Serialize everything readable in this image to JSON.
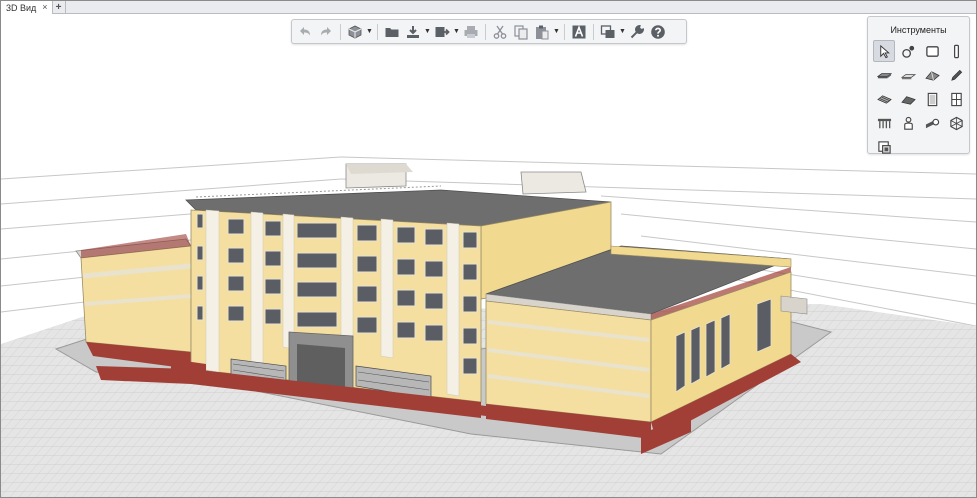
{
  "tabs": [
    {
      "label": "3D Вид",
      "close_glyph": "×"
    }
  ],
  "add_tab_glyph": "+",
  "toolbar": {
    "buttons": [
      {
        "name": "undo-button",
        "icon": "undo-icon"
      },
      {
        "name": "redo-button",
        "icon": "redo-icon"
      },
      {
        "name": "view-cube-button",
        "icon": "cube-icon",
        "dropdown": true
      },
      {
        "name": "open-folder-button",
        "icon": "folder-icon"
      },
      {
        "name": "import-button",
        "icon": "import-icon",
        "dropdown": true
      },
      {
        "name": "export-button",
        "icon": "export-icon",
        "dropdown": true
      },
      {
        "name": "print-button",
        "icon": "printer-icon"
      },
      {
        "name": "cut-button",
        "icon": "scissors-icon"
      },
      {
        "name": "copy-button",
        "icon": "copy-icon"
      },
      {
        "name": "paste-button",
        "icon": "paste-icon",
        "dropdown": true
      },
      {
        "name": "text-style-button",
        "icon": "text-a-icon"
      },
      {
        "name": "layers-button",
        "icon": "layers-icon",
        "dropdown": true
      },
      {
        "name": "settings-button",
        "icon": "wrench-icon"
      },
      {
        "name": "help-button",
        "icon": "help-icon"
      }
    ]
  },
  "tools_panel": {
    "title": "Инструменты",
    "selected": "select-pointer",
    "items": [
      "select-pointer",
      "node-link",
      "rectangle",
      "column",
      "slab",
      "beam",
      "roof",
      "pencil",
      "stair",
      "ramp",
      "door",
      "window",
      "railing",
      "object",
      "pipe",
      "mesh",
      "zone"
    ]
  },
  "colors": {
    "accent": "#3b6fb6",
    "wall": "#f5dfa0",
    "base": "#a13f36",
    "roof": "#6e6e6e",
    "trim": "#d8d4cc"
  }
}
